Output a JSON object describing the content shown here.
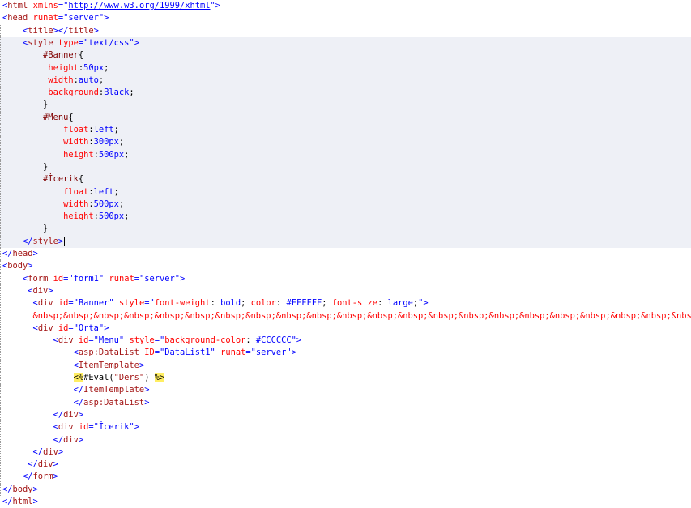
{
  "colors": {
    "bracket": "#0000ff",
    "tag": "#a31515",
    "attribute": "#ff0000",
    "attribute_value": "#0000ff",
    "css_selector": "#800000",
    "css_property": "#ff0000",
    "css_value": "#0000ff",
    "text": "#000000",
    "server_delimiter_bg": "#ffee62",
    "current_block_bg": "#eef0f6"
  },
  "lines": [
    [
      [
        "br",
        "<"
      ],
      [
        "tg",
        "html"
      ],
      [
        "tx",
        " "
      ],
      [
        "at",
        "xmlns"
      ],
      [
        "br",
        "=\""
      ],
      [
        "lk",
        "http://www.w3.org/1999/xhtml"
      ],
      [
        "br",
        "\">"
      ]
    ],
    [
      [
        "br",
        "<"
      ],
      [
        "tg",
        "head"
      ],
      [
        "tx",
        " "
      ],
      [
        "at",
        "runat"
      ],
      [
        "br",
        "="
      ],
      [
        "av",
        "\"server\""
      ],
      [
        "br",
        ">"
      ]
    ],
    [
      [
        "tx",
        "    "
      ],
      [
        "br",
        "<"
      ],
      [
        "tg",
        "title"
      ],
      [
        "br",
        "></"
      ],
      [
        "tg",
        "title"
      ],
      [
        "br",
        ">"
      ]
    ],
    [
      [
        "tx",
        "    "
      ],
      [
        "br",
        "<"
      ],
      [
        "tg",
        "style"
      ],
      [
        "tx",
        " "
      ],
      [
        "at",
        "type"
      ],
      [
        "br",
        "="
      ],
      [
        "av",
        "\"text/css\""
      ],
      [
        "br",
        ">"
      ]
    ],
    [
      [
        "tx",
        "        "
      ],
      [
        "sl",
        "#Banner"
      ],
      [
        "tx",
        "{"
      ]
    ],
    [
      [
        "tx",
        "         "
      ],
      [
        "pn",
        "height"
      ],
      [
        "tx",
        ":"
      ],
      [
        "vl",
        "50px"
      ],
      [
        "tx",
        ";"
      ]
    ],
    [
      [
        "tx",
        "         "
      ],
      [
        "pn",
        "width"
      ],
      [
        "tx",
        ":"
      ],
      [
        "vl",
        "auto"
      ],
      [
        "tx",
        ";"
      ]
    ],
    [
      [
        "tx",
        "         "
      ],
      [
        "pn",
        "background"
      ],
      [
        "tx",
        ":"
      ],
      [
        "vl",
        "Black"
      ],
      [
        "tx",
        ";"
      ]
    ],
    [
      [
        "tx",
        "        }"
      ]
    ],
    [
      [
        "tx",
        "        "
      ],
      [
        "sl",
        "#Menu"
      ],
      [
        "tx",
        "{"
      ]
    ],
    [
      [
        "tx",
        "            "
      ],
      [
        "pn",
        "float"
      ],
      [
        "tx",
        ":"
      ],
      [
        "vl",
        "left"
      ],
      [
        "tx",
        ";"
      ]
    ],
    [
      [
        "tx",
        "            "
      ],
      [
        "pn",
        "width"
      ],
      [
        "tx",
        ":"
      ],
      [
        "vl",
        "300px"
      ],
      [
        "tx",
        ";"
      ]
    ],
    [
      [
        "tx",
        "            "
      ],
      [
        "pn",
        "height"
      ],
      [
        "tx",
        ":"
      ],
      [
        "vl",
        "500px"
      ],
      [
        "tx",
        ";"
      ]
    ],
    [
      [
        "tx",
        "        }"
      ]
    ],
    [
      [
        "tx",
        "        "
      ],
      [
        "sl",
        "#İcerik"
      ],
      [
        "tx",
        "{"
      ]
    ],
    [
      [
        "tx",
        "            "
      ],
      [
        "pn",
        "float"
      ],
      [
        "tx",
        ":"
      ],
      [
        "vl",
        "left"
      ],
      [
        "tx",
        ";"
      ]
    ],
    [
      [
        "tx",
        "            "
      ],
      [
        "pn",
        "width"
      ],
      [
        "tx",
        ":"
      ],
      [
        "vl",
        "500px"
      ],
      [
        "tx",
        ";"
      ]
    ],
    [
      [
        "tx",
        "            "
      ],
      [
        "pn",
        "height"
      ],
      [
        "tx",
        ":"
      ],
      [
        "vl",
        "500px"
      ],
      [
        "tx",
        ";"
      ]
    ],
    [
      [
        "tx",
        "        }"
      ]
    ],
    [
      [
        "tx",
        "    "
      ],
      [
        "br",
        "</"
      ],
      [
        "tg",
        "style"
      ],
      [
        "br",
        ">"
      ],
      [
        "cursor",
        ""
      ]
    ],
    [
      [
        "br",
        "</"
      ],
      [
        "tg",
        "head"
      ],
      [
        "br",
        ">"
      ]
    ],
    [
      [
        "br",
        "<"
      ],
      [
        "tg",
        "body"
      ],
      [
        "br",
        ">"
      ]
    ],
    [
      [
        "tx",
        "    "
      ],
      [
        "br",
        "<"
      ],
      [
        "tg",
        "form"
      ],
      [
        "tx",
        " "
      ],
      [
        "at",
        "id"
      ],
      [
        "br",
        "="
      ],
      [
        "av",
        "\"form1\""
      ],
      [
        "tx",
        " "
      ],
      [
        "at",
        "runat"
      ],
      [
        "br",
        "="
      ],
      [
        "av",
        "\"server\""
      ],
      [
        "br",
        ">"
      ]
    ],
    [
      [
        "tx",
        "     "
      ],
      [
        "br",
        "<"
      ],
      [
        "tg",
        "div"
      ],
      [
        "br",
        ">"
      ]
    ],
    [
      [
        "tx",
        "      "
      ],
      [
        "br",
        "<"
      ],
      [
        "tg",
        "div"
      ],
      [
        "tx",
        " "
      ],
      [
        "at",
        "id"
      ],
      [
        "br",
        "="
      ],
      [
        "av",
        "\"Banner\""
      ],
      [
        "tx",
        " "
      ],
      [
        "at",
        "style"
      ],
      [
        "br",
        "=\""
      ],
      [
        "pn",
        "font-weight"
      ],
      [
        "tx",
        ": "
      ],
      [
        "av",
        "bold"
      ],
      [
        "tx",
        "; "
      ],
      [
        "pn",
        "color"
      ],
      [
        "tx",
        ": "
      ],
      [
        "av",
        "#FFFFFF"
      ],
      [
        "tx",
        "; "
      ],
      [
        "pn",
        "font-size"
      ],
      [
        "tx",
        ": "
      ],
      [
        "av",
        "large"
      ],
      [
        "tx",
        ";"
      ],
      [
        "br",
        "\">"
      ]
    ],
    [
      [
        "tx",
        "      "
      ],
      [
        "at",
        "&nbsp;&nbsp;&nbsp;&nbsp;&nbsp;&nbsp;&nbsp;&nbsp;&nbsp;&nbsp;&nbsp;&nbsp;&nbsp;&nbsp;&nbsp;&nbsp;&nbsp;&nbsp;&nbsp;&nbsp;&nbsp;&nbsp;&nbsp;&nbsp;&"
      ]
    ],
    [
      [
        "tx",
        "      "
      ],
      [
        "br",
        "<"
      ],
      [
        "tg",
        "div"
      ],
      [
        "tx",
        " "
      ],
      [
        "at",
        "id"
      ],
      [
        "br",
        "="
      ],
      [
        "av",
        "\"Orta\""
      ],
      [
        "br",
        ">"
      ]
    ],
    [
      [
        "tx",
        "          "
      ],
      [
        "br",
        "<"
      ],
      [
        "tg",
        "div"
      ],
      [
        "tx",
        " "
      ],
      [
        "at",
        "id"
      ],
      [
        "br",
        "="
      ],
      [
        "av",
        "\"Menu\""
      ],
      [
        "tx",
        " "
      ],
      [
        "at",
        "style"
      ],
      [
        "br",
        "=\""
      ],
      [
        "pn",
        "background-color"
      ],
      [
        "tx",
        ": "
      ],
      [
        "av",
        "#CCCCCC"
      ],
      [
        "br",
        "\">"
      ]
    ],
    [
      [
        "tx",
        "              "
      ],
      [
        "br",
        "<"
      ],
      [
        "tg",
        "asp:DataList"
      ],
      [
        "tx",
        " "
      ],
      [
        "at",
        "ID"
      ],
      [
        "br",
        "="
      ],
      [
        "av",
        "\"DataList1\""
      ],
      [
        "tx",
        " "
      ],
      [
        "at",
        "runat"
      ],
      [
        "br",
        "="
      ],
      [
        "av",
        "\"server\""
      ],
      [
        "br",
        ">"
      ]
    ],
    [
      [
        "tx",
        "              "
      ],
      [
        "br",
        "<"
      ],
      [
        "tg",
        "ItemTemplate"
      ],
      [
        "br",
        ">"
      ]
    ],
    [
      [
        "tx",
        "              "
      ],
      [
        "sv",
        "<%"
      ],
      [
        "tx",
        "#Eval("
      ],
      [
        "tg",
        "\"Ders\""
      ],
      [
        "tx",
        ") "
      ],
      [
        "sv",
        "%>"
      ]
    ],
    [
      [
        "tx",
        "              "
      ],
      [
        "br",
        "</"
      ],
      [
        "tg",
        "ItemTemplate"
      ],
      [
        "br",
        ">"
      ]
    ],
    [
      [
        "tx",
        "              "
      ],
      [
        "br",
        "</"
      ],
      [
        "tg",
        "asp:DataList"
      ],
      [
        "br",
        ">"
      ]
    ],
    [
      [
        "tx",
        "          "
      ],
      [
        "br",
        "</"
      ],
      [
        "tg",
        "div"
      ],
      [
        "br",
        ">"
      ]
    ],
    [
      [
        "tx",
        "          "
      ],
      [
        "br",
        "<"
      ],
      [
        "tg",
        "div"
      ],
      [
        "tx",
        " "
      ],
      [
        "at",
        "id"
      ],
      [
        "br",
        "="
      ],
      [
        "av",
        "\"İcerik\""
      ],
      [
        "br",
        ">"
      ]
    ],
    [
      [
        "tx",
        "          "
      ],
      [
        "br",
        "</"
      ],
      [
        "tg",
        "div"
      ],
      [
        "br",
        ">"
      ]
    ],
    [
      [
        "tx",
        "      "
      ],
      [
        "br",
        "</"
      ],
      [
        "tg",
        "div"
      ],
      [
        "br",
        ">"
      ]
    ],
    [
      [
        "tx",
        "     "
      ],
      [
        "br",
        "</"
      ],
      [
        "tg",
        "div"
      ],
      [
        "br",
        ">"
      ]
    ],
    [
      [
        "tx",
        "    "
      ],
      [
        "br",
        "</"
      ],
      [
        "tg",
        "form"
      ],
      [
        "br",
        ">"
      ]
    ],
    [
      [
        "br",
        "</"
      ],
      [
        "tg",
        "body"
      ],
      [
        "br",
        ">"
      ]
    ],
    [
      [
        "br",
        "</"
      ],
      [
        "tg",
        "html"
      ],
      [
        "br",
        ">"
      ]
    ]
  ]
}
